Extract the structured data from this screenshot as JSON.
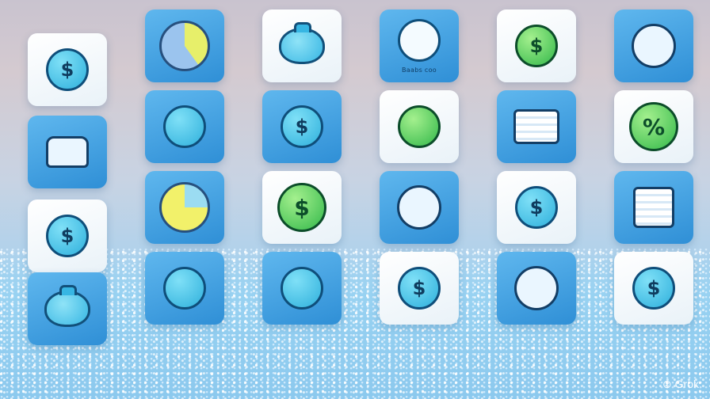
{
  "watermark": "Grok",
  "tiles": [
    {
      "caption": "Baabs coo"
    }
  ],
  "glyphs": {
    "dollar": "$",
    "percent": "%"
  },
  "colors": {
    "tile_blue": "#3b9fe0",
    "tile_white": "#f7fbfe",
    "coin_teal": "#2fb0dc",
    "coin_green": "#33b84a",
    "accent_dark": "#0f4e7a"
  }
}
